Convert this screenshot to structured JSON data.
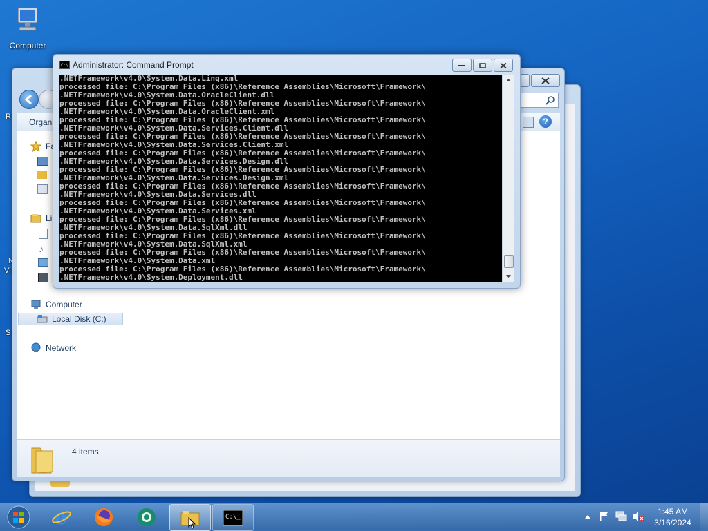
{
  "desktop": {
    "icons": [
      {
        "label": "Computer",
        "icon": "computer-icon"
      }
    ],
    "left_fragments": [
      "R",
      "N",
      "Vi",
      "S"
    ]
  },
  "explorer": {
    "toolbar": {
      "organize_label": "Organ"
    },
    "nav": {
      "favorites_label": "Fa",
      "libraries_label": "Li",
      "computer_label": "Computer",
      "local_disk_label": "Local Disk (C:)",
      "network_label": "Network"
    },
    "details": {
      "items_count": "4 items"
    }
  },
  "cmd": {
    "title": "Administrator: Command Prompt",
    "lines": [
      ".NETFramework\\v4.0\\System.Data.Linq.xml",
      "processed file: C:\\Program Files (x86)\\Reference Assemblies\\Microsoft\\Framework\\",
      ".NETFramework\\v4.0\\System.Data.OracleClient.dll",
      "processed file: C:\\Program Files (x86)\\Reference Assemblies\\Microsoft\\Framework\\",
      ".NETFramework\\v4.0\\System.Data.OracleClient.xml",
      "processed file: C:\\Program Files (x86)\\Reference Assemblies\\Microsoft\\Framework\\",
      ".NETFramework\\v4.0\\System.Data.Services.Client.dll",
      "processed file: C:\\Program Files (x86)\\Reference Assemblies\\Microsoft\\Framework\\",
      ".NETFramework\\v4.0\\System.Data.Services.Client.xml",
      "processed file: C:\\Program Files (x86)\\Reference Assemblies\\Microsoft\\Framework\\",
      ".NETFramework\\v4.0\\System.Data.Services.Design.dll",
      "processed file: C:\\Program Files (x86)\\Reference Assemblies\\Microsoft\\Framework\\",
      ".NETFramework\\v4.0\\System.Data.Services.Design.xml",
      "processed file: C:\\Program Files (x86)\\Reference Assemblies\\Microsoft\\Framework\\",
      ".NETFramework\\v4.0\\System.Data.Services.dll",
      "processed file: C:\\Program Files (x86)\\Reference Assemblies\\Microsoft\\Framework\\",
      ".NETFramework\\v4.0\\System.Data.Services.xml",
      "processed file: C:\\Program Files (x86)\\Reference Assemblies\\Microsoft\\Framework\\",
      ".NETFramework\\v4.0\\System.Data.SqlXml.dll",
      "processed file: C:\\Program Files (x86)\\Reference Assemblies\\Microsoft\\Framework\\",
      ".NETFramework\\v4.0\\System.Data.SqlXml.xml",
      "processed file: C:\\Program Files (x86)\\Reference Assemblies\\Microsoft\\Framework\\",
      ".NETFramework\\v4.0\\System.Data.xml",
      "processed file: C:\\Program Files (x86)\\Reference Assemblies\\Microsoft\\Framework\\",
      ".NETFramework\\v4.0\\System.Deployment.dll"
    ]
  },
  "taskbar": {
    "buttons": [
      {
        "name": "start-button",
        "icon": "windows-logo-icon"
      },
      {
        "name": "internet-explorer-button",
        "icon": "internet-explorer-icon"
      },
      {
        "name": "firefox-button",
        "icon": "firefox-icon"
      },
      {
        "name": "app-button",
        "icon": "app-icon"
      },
      {
        "name": "explorer-button",
        "icon": "folder-icon"
      },
      {
        "name": "cmd-button",
        "icon": "command-prompt-icon"
      }
    ],
    "tray_icons": [
      "show-hidden-icons-icon",
      "action-center-flag-icon",
      "network-icon",
      "volume-muted-icon"
    ],
    "clock": {
      "time": "1:45 AM",
      "date": "3/16/2024"
    }
  },
  "colors": {
    "console_bg": "#000000",
    "console_text": "#c0c0c0",
    "desktop": "#1566c4"
  }
}
